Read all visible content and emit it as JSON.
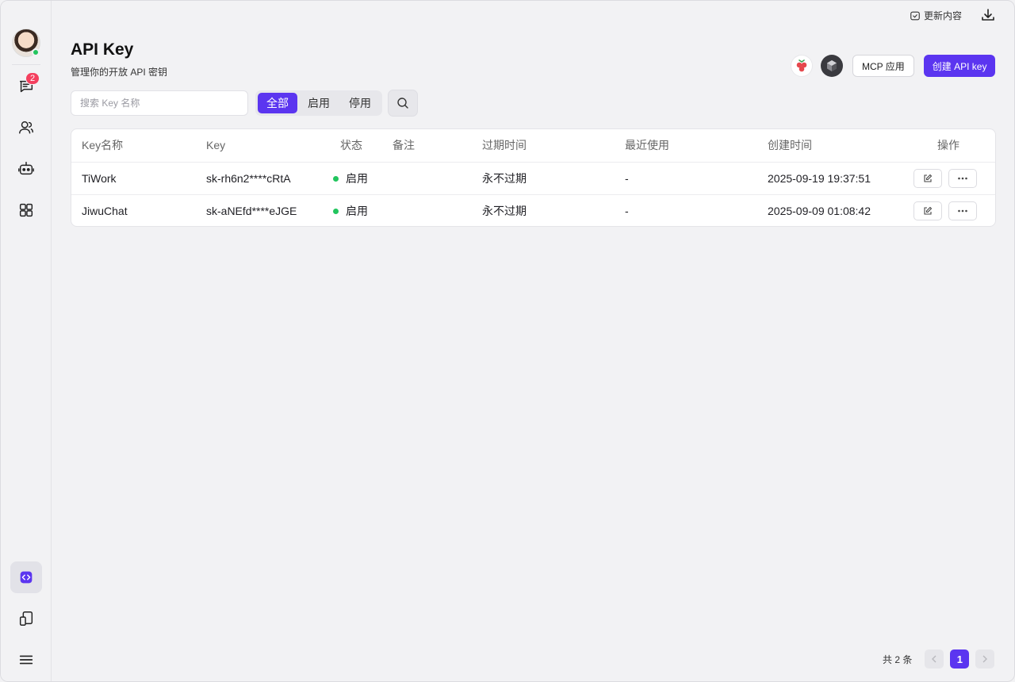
{
  "window": {
    "title": "API Key"
  },
  "sidebar": {
    "chat_badge": "2",
    "items": [
      {
        "name": "chat",
        "icon": "chat-icon"
      },
      {
        "name": "contacts",
        "icon": "contacts-icon"
      },
      {
        "name": "robot",
        "icon": "robot-icon"
      },
      {
        "name": "apps",
        "icon": "apps-grid-icon"
      },
      {
        "name": "api",
        "icon": "code-icon",
        "active": true
      },
      {
        "name": "device",
        "icon": "device-icon"
      },
      {
        "name": "menu",
        "icon": "menu-icon"
      }
    ]
  },
  "topbar": {
    "update_label": "更新内容"
  },
  "header": {
    "title": "API Key",
    "subtitle": "管理你的开放 API 密钥",
    "mcp_button": "MCP 应用",
    "create_button": "创建 API key"
  },
  "filters": {
    "search_placeholder": "搜索 Key 名称",
    "tabs": [
      "全部",
      "启用",
      "停用"
    ],
    "active_tab": "全部"
  },
  "table": {
    "columns": [
      "Key名称",
      "Key",
      "状态",
      "备注",
      "过期时间",
      "最近使用",
      "创建时间",
      "操作"
    ],
    "rows": [
      {
        "name": "TiWork",
        "key": "sk-rh6n2****cRtA",
        "status": "启用",
        "note": "",
        "expire": "永不过期",
        "last_used": "-",
        "created": "2025-09-19 19:37:51"
      },
      {
        "name": "JiwuChat",
        "key": "sk-aNEfd****eJGE",
        "status": "启用",
        "note": "",
        "expire": "永不过期",
        "last_used": "-",
        "created": "2025-09-09 01:08:42"
      }
    ]
  },
  "pagination": {
    "total_label": "共 2 条",
    "current_page": "1"
  },
  "colors": {
    "accent": "#5b35f0",
    "status_on": "#22c55e",
    "badge": "#f43f5e"
  }
}
